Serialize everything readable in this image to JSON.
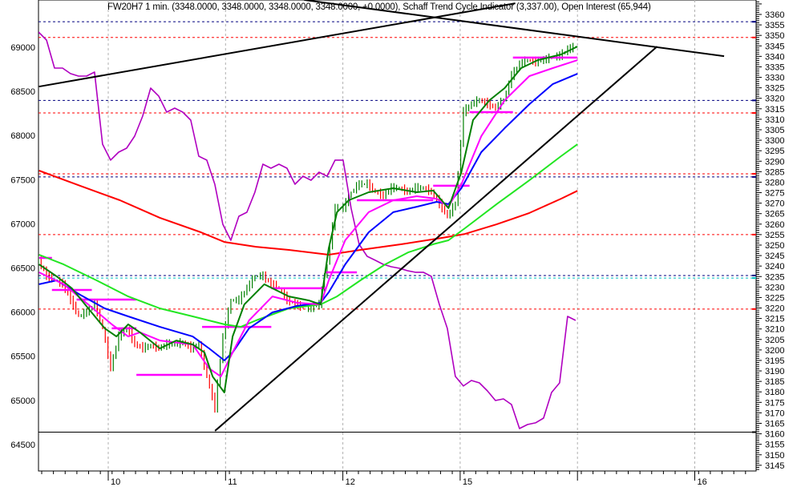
{
  "chart_data": {
    "type": "line",
    "title": "FW20H7 1 min. (3348.0000, 3348.0000, 3348.0000, 3348.0000, +0.0000), Schaff Trend Cycle Indicator (3,337.00), Open Interest (65,944)",
    "x_axis": {
      "ticks": [
        {
          "x": 1,
          "label": "10"
        },
        {
          "x": 2,
          "label": "11"
        },
        {
          "x": 3,
          "label": "12"
        },
        {
          "x": 4,
          "label": "15"
        },
        {
          "x": 6,
          "label": "16"
        }
      ],
      "gridlines": [
        1,
        2,
        3,
        4,
        5,
        6
      ],
      "range": [
        0.4,
        6.5
      ]
    },
    "right_axis": {
      "range": [
        3143,
        3367
      ],
      "ticks": [
        3360,
        3355,
        3350,
        3345,
        3340,
        3335,
        3330,
        3325,
        3320,
        3315,
        3310,
        3305,
        3300,
        3295,
        3290,
        3285,
        3280,
        3275,
        3270,
        3265,
        3260,
        3255,
        3250,
        3245,
        3240,
        3235,
        3230,
        3225,
        3220,
        3215,
        3210,
        3205,
        3200,
        3195,
        3190,
        3185,
        3180,
        3175,
        3170,
        3165,
        3160,
        3155,
        3150,
        3145
      ]
    },
    "left_axis": {
      "range": [
        64200,
        69540
      ],
      "ticks": [
        69000,
        68500,
        68000,
        67500,
        67000,
        66500,
        66000,
        65500,
        65000,
        64500
      ]
    },
    "price": {
      "name": "FW20H7 1 min.",
      "axis": "right",
      "x0": 0.405,
      "dx": 0.06835,
      "up_color": "#008000",
      "down_color": "#ff0000",
      "values": [
        3242.7,
        3235.1,
        3233.2,
        3231.3,
        3223.6,
        3216.0,
        3217.9,
        3221.7,
        3210.3,
        3191.2,
        3206.4,
        3210.3,
        3202.6,
        3200.7,
        3201.9,
        3200.7,
        3202.6,
        3202.6,
        3203.4,
        3200.7,
        3202.6,
        3187.4,
        3172.1,
        3206.4,
        3223.6,
        3223.6,
        3229.4,
        3235.1,
        3235.1,
        3231.3,
        3229.4,
        3223.6,
        3221.7,
        3219.8,
        3219.8,
        3221.7,
        3240.8,
        3267.6,
        3267.6,
        3275.2,
        3279.0,
        3279.0,
        3275.2,
        3273.3,
        3277.1,
        3277.1,
        3275.2,
        3277.1,
        3277.1,
        3275.2,
        3269.5,
        3263.7,
        3269.5,
        3313.4,
        3317.2,
        3319.1,
        3317.2,
        3315.3,
        3319.1,
        3330.6,
        3336.3,
        3338.2,
        3337.1,
        3338.2,
        3339.4,
        3340.1,
        3343.2,
        3344.7
      ]
    },
    "series": [
      {
        "name": "Open Interest",
        "axis": "left",
        "color": "#b000c0",
        "x0": 0.405,
        "dx": 0.06835,
        "values": [
          69172,
          69082,
          68764,
          68764,
          68701,
          68673,
          68673,
          68719,
          67902,
          67721,
          67811,
          67857,
          67993,
          68220,
          68537,
          68447,
          68265,
          68310,
          68265,
          68174,
          67766,
          67721,
          67448,
          66995,
          66813,
          67085,
          67131,
          67358,
          67675,
          67630,
          67675,
          67630,
          67448,
          67539,
          67494,
          67584,
          67539,
          67721,
          67721,
          67176,
          66768,
          66632,
          66587,
          66541,
          66514,
          66496,
          66469,
          66451,
          66451,
          66405,
          66087,
          65815,
          65271,
          65162,
          65225,
          65198,
          65107,
          64998,
          65016,
          64953,
          64681,
          64726,
          64745,
          64799,
          65089,
          65198,
          65951,
          65906
        ]
      },
      {
        "name": "MA slow (red)",
        "axis": "right",
        "color": "#ff0000",
        "points": [
          [
            0.41,
            3285.5
          ],
          [
            0.76,
            3278.3
          ],
          [
            1.1,
            3271.4
          ],
          [
            1.44,
            3263.0
          ],
          [
            1.79,
            3256.1
          ],
          [
            1.99,
            3251.5
          ],
          [
            2.26,
            3249.2
          ],
          [
            2.54,
            3247.7
          ],
          [
            2.88,
            3245.4
          ],
          [
            3.15,
            3247.7
          ],
          [
            3.5,
            3250.4
          ],
          [
            3.84,
            3253.4
          ],
          [
            4.04,
            3255.3
          ],
          [
            4.31,
            3259.9
          ],
          [
            4.59,
            3265.3
          ],
          [
            4.86,
            3272.1
          ],
          [
            5.0,
            3275.9
          ]
        ]
      },
      {
        "name": "MA lime",
        "axis": "right",
        "color": "#22e622",
        "points": [
          [
            0.41,
            3245.4
          ],
          [
            0.62,
            3240.8
          ],
          [
            0.9,
            3233.2
          ],
          [
            1.17,
            3225.5
          ],
          [
            1.44,
            3219.8
          ],
          [
            1.72,
            3216.0
          ],
          [
            1.99,
            3212.2
          ],
          [
            2.13,
            3211.0
          ],
          [
            2.26,
            3214.1
          ],
          [
            2.54,
            3219.8
          ],
          [
            2.81,
            3221.7
          ],
          [
            2.95,
            3225.5
          ],
          [
            3.15,
            3233.2
          ],
          [
            3.36,
            3240.8
          ],
          [
            3.56,
            3246.6
          ],
          [
            3.77,
            3250.4
          ],
          [
            3.9,
            3252.3
          ],
          [
            4.04,
            3258.0
          ],
          [
            4.31,
            3269.5
          ],
          [
            4.59,
            3280.9
          ],
          [
            4.86,
            3292.4
          ],
          [
            5.0,
            3298.1
          ]
        ]
      },
      {
        "name": "MA blue",
        "axis": "right",
        "color": "#0000ff",
        "points": [
          [
            0.41,
            3231.3
          ],
          [
            0.56,
            3233.2
          ],
          [
            0.76,
            3226.3
          ],
          [
            0.97,
            3219.8
          ],
          [
            1.17,
            3216.0
          ],
          [
            1.44,
            3211.0
          ],
          [
            1.72,
            3206.4
          ],
          [
            1.86,
            3200.7
          ],
          [
            1.99,
            3195.0
          ],
          [
            2.06,
            3198.8
          ],
          [
            2.2,
            3210.3
          ],
          [
            2.4,
            3217.9
          ],
          [
            2.61,
            3221.0
          ],
          [
            2.81,
            3222.5
          ],
          [
            2.88,
            3227.5
          ],
          [
            3.02,
            3240.8
          ],
          [
            3.22,
            3256.1
          ],
          [
            3.43,
            3265.7
          ],
          [
            3.63,
            3268.3
          ],
          [
            3.8,
            3270.6
          ],
          [
            3.9,
            3269.5
          ],
          [
            4.01,
            3277.1
          ],
          [
            4.18,
            3294.3
          ],
          [
            4.38,
            3305.8
          ],
          [
            4.59,
            3317.2
          ],
          [
            4.79,
            3326.8
          ],
          [
            5.0,
            3331.7
          ]
        ]
      },
      {
        "name": "MA magenta",
        "axis": "right",
        "color": "#ff00ff",
        "points": [
          [
            0.41,
            3237.0
          ],
          [
            0.62,
            3231.3
          ],
          [
            0.83,
            3221.7
          ],
          [
            1.03,
            3212.2
          ],
          [
            1.17,
            3206.4
          ],
          [
            1.27,
            3208.4
          ],
          [
            1.44,
            3204.5
          ],
          [
            1.72,
            3202.6
          ],
          [
            1.86,
            3191.2
          ],
          [
            1.96,
            3187.3
          ],
          [
            2.06,
            3198.8
          ],
          [
            2.2,
            3214.1
          ],
          [
            2.4,
            3225.5
          ],
          [
            2.61,
            3222.5
          ],
          [
            2.81,
            3221.7
          ],
          [
            2.88,
            3233.2
          ],
          [
            3.02,
            3252.3
          ],
          [
            3.22,
            3265.7
          ],
          [
            3.43,
            3271.4
          ],
          [
            3.63,
            3273.3
          ],
          [
            3.8,
            3272.1
          ],
          [
            3.9,
            3268.3
          ],
          [
            4.01,
            3279.0
          ],
          [
            4.18,
            3301.9
          ],
          [
            4.38,
            3319.1
          ],
          [
            4.59,
            3330.6
          ],
          [
            4.79,
            3334.4
          ],
          [
            5.0,
            3338.2
          ]
        ]
      },
      {
        "name": "MA fast (green)",
        "axis": "right",
        "color": "#008000",
        "points": [
          [
            0.41,
            3240.8
          ],
          [
            0.56,
            3235.1
          ],
          [
            0.69,
            3229.4
          ],
          [
            0.83,
            3219.8
          ],
          [
            0.97,
            3210.3
          ],
          [
            1.07,
            3206.4
          ],
          [
            1.17,
            3212.2
          ],
          [
            1.27,
            3208.4
          ],
          [
            1.44,
            3200.7
          ],
          [
            1.58,
            3204.5
          ],
          [
            1.72,
            3202.6
          ],
          [
            1.82,
            3198.8
          ],
          [
            1.89,
            3187.3
          ],
          [
            1.99,
            3179.7
          ],
          [
            2.06,
            3206.4
          ],
          [
            2.16,
            3221.7
          ],
          [
            2.33,
            3231.3
          ],
          [
            2.54,
            3225.5
          ],
          [
            2.71,
            3223.6
          ],
          [
            2.81,
            3221.7
          ],
          [
            2.88,
            3248.5
          ],
          [
            2.95,
            3265.7
          ],
          [
            3.05,
            3271.4
          ],
          [
            3.22,
            3275.2
          ],
          [
            3.43,
            3277.1
          ],
          [
            3.63,
            3275.2
          ],
          [
            3.77,
            3276.0
          ],
          [
            3.9,
            3267.6
          ],
          [
            4.01,
            3284.8
          ],
          [
            4.11,
            3309.6
          ],
          [
            4.25,
            3319.1
          ],
          [
            4.38,
            3324.9
          ],
          [
            4.52,
            3334.4
          ],
          [
            4.66,
            3338.2
          ],
          [
            4.86,
            3340.9
          ],
          [
            5.0,
            3344.7
          ]
        ]
      }
    ],
    "levels": {
      "color": "#ff00ff",
      "segments": [
        [
          0.41,
          0.52,
          3243.9
        ],
        [
          0.52,
          0.86,
          3228.6
        ],
        [
          0.73,
          1.24,
          3224.0
        ],
        [
          1.03,
          1.24,
          3210.3
        ],
        [
          1.24,
          1.8,
          3188.1
        ],
        [
          1.8,
          2.39,
          3211.0
        ],
        [
          2.39,
          2.85,
          3229.4
        ],
        [
          2.85,
          3.12,
          3237.0
        ],
        [
          3.12,
          3.77,
          3271.4
        ],
        [
          3.77,
          4.08,
          3278.3
        ],
        [
          4.08,
          4.45,
          3313.4
        ],
        [
          4.45,
          5.0,
          3339.4
        ]
      ]
    },
    "trendlines": {
      "color": "#000000",
      "lines": [
        [
          0.41,
          3325.6,
          4.47,
          3365.3
        ],
        [
          2.67,
          3366.9,
          6.25,
          3340.1
        ],
        [
          1.91,
          3161.4,
          5.68,
          3344.7
        ]
      ]
    },
    "horizontal_lines": [
      {
        "value": 3356.5,
        "color": "#000080",
        "style": "dashed"
      },
      {
        "value": 3349.0,
        "color": "#ff0000",
        "style": "dashed"
      },
      {
        "value": 3319.0,
        "color": "#000080",
        "style": "dashed"
      },
      {
        "value": 3313.0,
        "color": "#ff0000",
        "style": "dashed"
      },
      {
        "value": 3284.0,
        "color": "#ff0000",
        "style": "dashed"
      },
      {
        "value": 3282.5,
        "color": "#000080",
        "style": "dashed"
      },
      {
        "value": 3255.0,
        "color": "#ff0000",
        "style": "dashed"
      },
      {
        "value": 3235.5,
        "color": "#000080",
        "style": "dashed"
      },
      {
        "value": 3234.3,
        "color": "#00c0c0",
        "style": "dashed"
      },
      {
        "value": 3219.5,
        "color": "#ff0000",
        "style": "dashed"
      },
      {
        "value": 3160.8,
        "color": "#000000",
        "style": "solid"
      }
    ],
    "grid": true,
    "legend": "none"
  }
}
